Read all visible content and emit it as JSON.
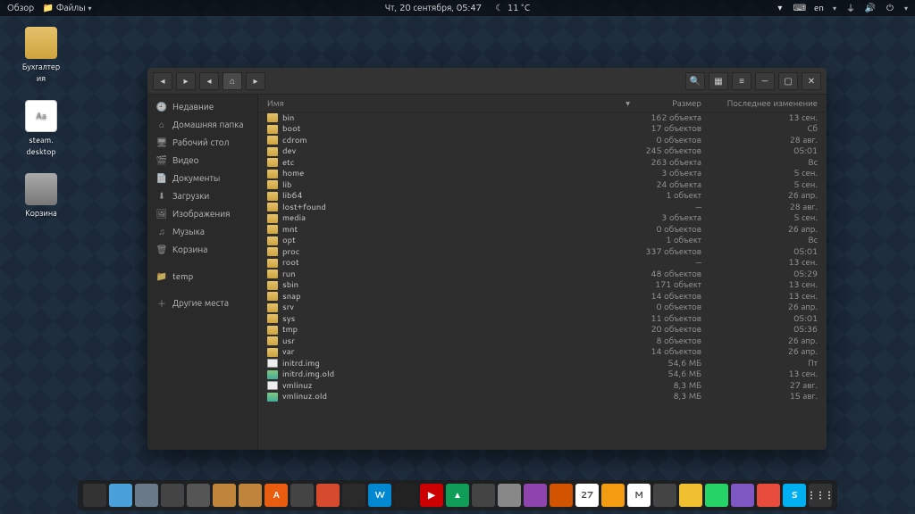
{
  "topbar": {
    "overview": "Обзор",
    "app": "Файлы",
    "datetime": "Чт, 20 сентября, 05:47",
    "weather": "11 °C",
    "lang": "en"
  },
  "desktop": {
    "icons": [
      {
        "name": "Бухгалтер\nия",
        "kind": "folder"
      },
      {
        "name": "steam.\ndesktop",
        "kind": "file"
      },
      {
        "name": "Корзина",
        "kind": "trash"
      }
    ]
  },
  "sidebar": [
    {
      "icon": "clock",
      "label": "Недавние"
    },
    {
      "icon": "home",
      "label": "Домашняя папка"
    },
    {
      "icon": "desk",
      "label": "Рабочий стол"
    },
    {
      "icon": "video",
      "label": "Видео"
    },
    {
      "icon": "doc",
      "label": "Документы"
    },
    {
      "icon": "dl",
      "label": "Загрузки"
    },
    {
      "icon": "img",
      "label": "Изображения"
    },
    {
      "icon": "music",
      "label": "Музыка"
    },
    {
      "icon": "trash",
      "label": "Корзина"
    },
    {
      "gap": true
    },
    {
      "icon": "folder",
      "label": "temp"
    },
    {
      "gap": true
    },
    {
      "icon": "plus",
      "label": "Другие места"
    }
  ],
  "columns": {
    "name": "Имя",
    "size": "Размер",
    "modified": "Последнее изменение"
  },
  "files": [
    {
      "name": "bin",
      "kind": "folder",
      "size": "162 объекта",
      "mod": "13 сен."
    },
    {
      "name": "boot",
      "kind": "folder",
      "size": "17 объектов",
      "mod": "Сб"
    },
    {
      "name": "cdrom",
      "kind": "folder",
      "size": "0 объектов",
      "mod": "28 авг."
    },
    {
      "name": "dev",
      "kind": "folder",
      "size": "245 объектов",
      "mod": "05:01"
    },
    {
      "name": "etc",
      "kind": "folder",
      "size": "263 объекта",
      "mod": "Вс"
    },
    {
      "name": "home",
      "kind": "folder",
      "size": "3 объекта",
      "mod": "5 сен."
    },
    {
      "name": "lib",
      "kind": "folder",
      "size": "24 объекта",
      "mod": "5 сен."
    },
    {
      "name": "lib64",
      "kind": "folder",
      "size": "1 объект",
      "mod": "26 апр."
    },
    {
      "name": "lost+found",
      "kind": "folder",
      "size": "—",
      "mod": "28 авг."
    },
    {
      "name": "media",
      "kind": "folder",
      "size": "3 объекта",
      "mod": "5 сен."
    },
    {
      "name": "mnt",
      "kind": "folder",
      "size": "0 объектов",
      "mod": "26 апр."
    },
    {
      "name": "opt",
      "kind": "folder",
      "size": "1 объект",
      "mod": "Вс"
    },
    {
      "name": "proc",
      "kind": "folder",
      "size": "337 объектов",
      "mod": "05:01"
    },
    {
      "name": "root",
      "kind": "folder",
      "size": "—",
      "mod": "13 сен."
    },
    {
      "name": "run",
      "kind": "folder",
      "size": "48 объектов",
      "mod": "05:29"
    },
    {
      "name": "sbin",
      "kind": "folder",
      "size": "171 объект",
      "mod": "13 сен."
    },
    {
      "name": "snap",
      "kind": "folder",
      "size": "14 объектов",
      "mod": "13 сен."
    },
    {
      "name": "srv",
      "kind": "folder",
      "size": "0 объектов",
      "mod": "26 апр."
    },
    {
      "name": "sys",
      "kind": "folder",
      "size": "11 объектов",
      "mod": "05:01"
    },
    {
      "name": "tmp",
      "kind": "folder",
      "size": "20 объектов",
      "mod": "05:36"
    },
    {
      "name": "usr",
      "kind": "folder",
      "size": "8 объектов",
      "mod": "26 апр."
    },
    {
      "name": "var",
      "kind": "folder",
      "size": "14 объектов",
      "mod": "26 апр."
    },
    {
      "name": "initrd.img",
      "kind": "file",
      "size": "54,6 МБ",
      "mod": "Пт"
    },
    {
      "name": "initrd.img.old",
      "kind": "img",
      "size": "54,6 МБ",
      "mod": "13 сен."
    },
    {
      "name": "vmlinuz",
      "kind": "file",
      "size": "8,3 МБ",
      "mod": "27 авг."
    },
    {
      "name": "vmlinuz.old",
      "kind": "img",
      "size": "8,3 МБ",
      "mod": "15 авг."
    }
  ],
  "dock": [
    {
      "c": "#333"
    },
    {
      "c": "#4aa0d8"
    },
    {
      "c": "#6a7a8a"
    },
    {
      "c": "#444"
    },
    {
      "c": "#555"
    },
    {
      "c": "#c0853a"
    },
    {
      "c": "#c0853a"
    },
    {
      "c": "#e85d0f",
      "t": "A"
    },
    {
      "c": "#444"
    },
    {
      "c": "#d64a2e"
    },
    {
      "c": "#2a2a2a"
    },
    {
      "c": "#0288d1",
      "t": "W"
    },
    {
      "c": "#222"
    },
    {
      "c": "#cc0000",
      "t": "▶"
    },
    {
      "c": "#0f9d58",
      "t": "▲"
    },
    {
      "c": "#444"
    },
    {
      "c": "#888"
    },
    {
      "c": "#8e44ad"
    },
    {
      "c": "#d35400"
    },
    {
      "c": "#fff",
      "t": "27"
    },
    {
      "c": "#f39c12"
    },
    {
      "c": "#fff",
      "t": "M"
    },
    {
      "c": "#444"
    },
    {
      "c": "#f0c030"
    },
    {
      "c": "#25d366"
    },
    {
      "c": "#7e57c2"
    },
    {
      "c": "#e74c3c"
    },
    {
      "c": "#00aff0",
      "t": "S"
    },
    {
      "c": "#333",
      "t": "⋮⋮⋮"
    }
  ]
}
